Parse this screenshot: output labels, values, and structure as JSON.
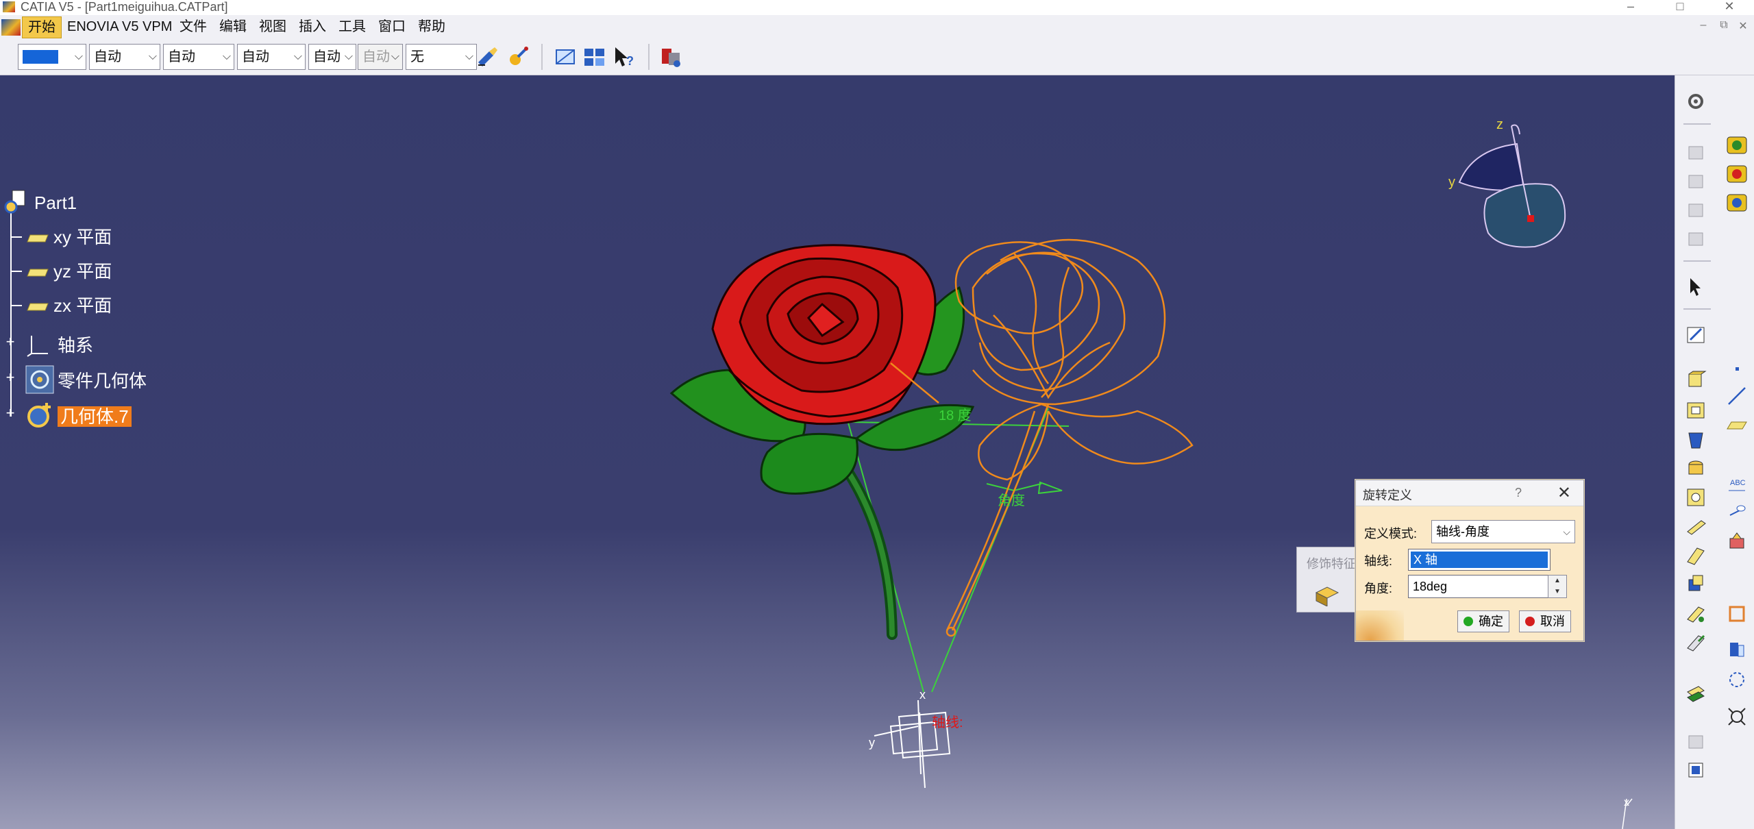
{
  "window": {
    "title": "CATIA V5 - [Part1meiguihua.CATPart]",
    "controls": [
      "–",
      "□",
      "✕"
    ]
  },
  "menubar": {
    "items": [
      "开始",
      "ENOVIA V5 VPM",
      "文件",
      "编辑",
      "视图",
      "插入",
      "工具",
      "窗口",
      "帮助"
    ],
    "mdi_controls": [
      "–",
      "⧉",
      "✕"
    ]
  },
  "toolbar": {
    "combos": [
      "自动",
      "自动",
      "自动",
      "自动",
      "自动",
      "无"
    ],
    "color_swatch": "#1565d8"
  },
  "tree": {
    "root": "Part1",
    "items": [
      {
        "label": "xy 平面",
        "icon": "plane-icon"
      },
      {
        "label": "yz 平面",
        "icon": "plane-icon"
      },
      {
        "label": "zx 平面",
        "icon": "plane-icon"
      },
      {
        "label": "轴系",
        "icon": "axis-system-icon"
      },
      {
        "label": "零件几何体",
        "icon": "part-body-icon"
      },
      {
        "label": "几何体.7",
        "icon": "body-icon",
        "selected": true
      }
    ]
  },
  "viewport": {
    "angle_annotation": "18 度",
    "angle_label": "角度",
    "axis_label": "轴线:",
    "compass_labels": {
      "z": "z",
      "y": "y",
      "x": "x"
    },
    "corner_axis_labels": {
      "y": "y",
      "x": "x"
    }
  },
  "ghost_toolbar": {
    "title": "修饰特征"
  },
  "dialog": {
    "title": "旋转定义",
    "help": "?",
    "close": "✕",
    "mode_label": "定义模式:",
    "mode_value": "轴线-角度",
    "axis_label": "轴线:",
    "axis_value": "X 轴",
    "angle_label": "角度:",
    "angle_value": "18deg",
    "ok_label": "确定",
    "cancel_label": "取消"
  },
  "colors": {
    "viewport_top": "#363b6c",
    "rose_red": "#c41414",
    "leaf_green": "#1f8a1f",
    "wire_orange": "#f08a1c",
    "selection_orange": "#f07c1b",
    "dialog_bg": "#fbe9c7"
  }
}
